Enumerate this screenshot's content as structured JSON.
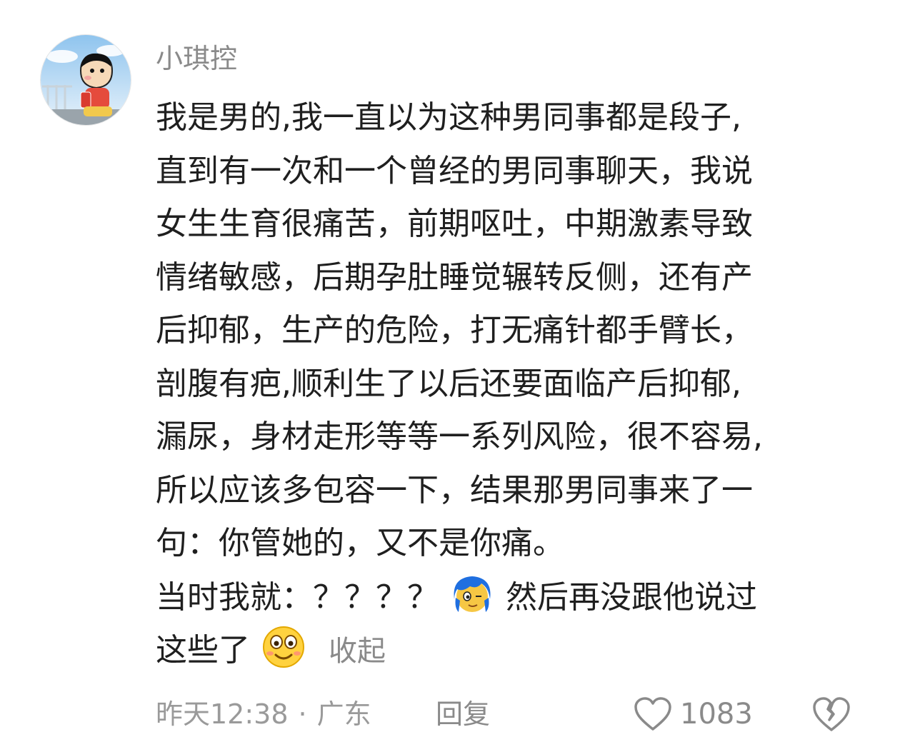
{
  "comment": {
    "username": "小琪控",
    "lines": [
      "我是男的,我一直以为这种男同事都是段子,",
      "直到有一次和一个曾经的男同事聊天，我说",
      "女生生育很痛苦，前期呕吐，中期激素导致",
      "情绪敏感，后期孕肚睡觉辗转反侧，还有产",
      "后抑郁，生产的危险，打无痛针都手臂长，",
      "剖腹有疤,顺利生了以后还要面临产后抑郁,",
      "漏尿，身材走形等等一系列风险，很不容易,",
      "所以应该多包容一下，结果那男同事来了一",
      "句：你管她的，又不是你痛。"
    ],
    "line10_before_emoji": "当时我就：？？？？",
    "line10_after_emoji": "然后再没跟他说过",
    "line11_text": "这些了",
    "collapse_label": "收起",
    "emoji_1": "blue-hair-face-emoji",
    "emoji_2": "smiling-face-emoji",
    "time": "昨天12:38",
    "separator": "·",
    "location": "广东",
    "reply_label": "回复",
    "like_count": "1083",
    "like_icon": "heart-outline-icon",
    "dislike_icon": "broken-heart-outline-icon"
  },
  "colors": {
    "text": "#1f1f1f",
    "secondary_text": "#8a8a8a",
    "background": "#ffffff"
  }
}
